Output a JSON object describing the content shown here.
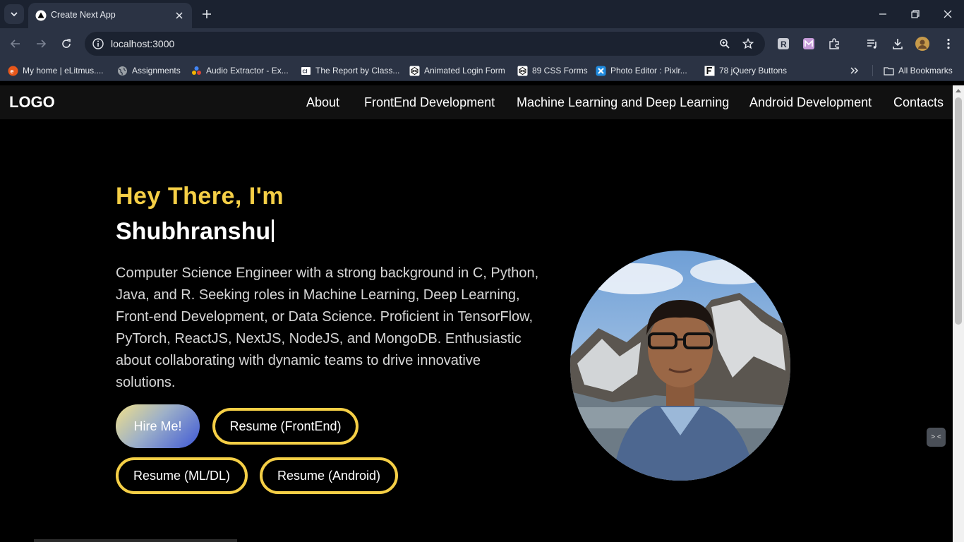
{
  "browser": {
    "tab_title": "Create Next App",
    "url": "localhost:3000",
    "bookmarks": [
      {
        "label": "My home | eLitmus....",
        "icon": "elitmus-icon"
      },
      {
        "label": "Assignments",
        "icon": "globe-icon"
      },
      {
        "label": "Audio Extractor - Ex...",
        "icon": "dots-icon"
      },
      {
        "label": "The Report by Class...",
        "icon": "report-icon"
      },
      {
        "label": "Animated Login Form",
        "icon": "codepen-icon"
      },
      {
        "label": "89 CSS Forms",
        "icon": "codepen-icon"
      },
      {
        "label": "Photo Editor : Pixlr...",
        "icon": "pixlr-icon"
      },
      {
        "label": "78 jQuery Buttons",
        "icon": "f-icon"
      }
    ],
    "all_bookmarks": "All Bookmarks"
  },
  "site": {
    "logo": "LOGO",
    "nav": [
      "About",
      "FrontEnd Development",
      "Machine Learning and Deep Learning",
      "Android Development",
      "Contacts"
    ]
  },
  "hero": {
    "greeting": "Hey There, I'm",
    "name": "Shubhranshu",
    "bio": "Computer Science Engineer with a strong background in C, Python, Java, and R. Seeking roles in Machine Learning, Deep Learning, Front-end Development, or Data Science. Proficient in TensorFlow, PyTorch, ReactJS, NextJS, NodeJS, and MongoDB. Enthusiastic about collaborating with dynamic teams to drive innovative solutions.",
    "buttons": {
      "hire": "Hire Me!",
      "resume_frontend": "Resume (FrontEnd)",
      "resume_mldl": "Resume (ML/DL)",
      "resume_android": "Resume (Android)"
    }
  },
  "floating_widget": "> <",
  "colors": {
    "accent": "#f5cf46",
    "page_bg": "#000000",
    "nav_bg": "#111111",
    "chrome_bg": "#2b3344"
  }
}
